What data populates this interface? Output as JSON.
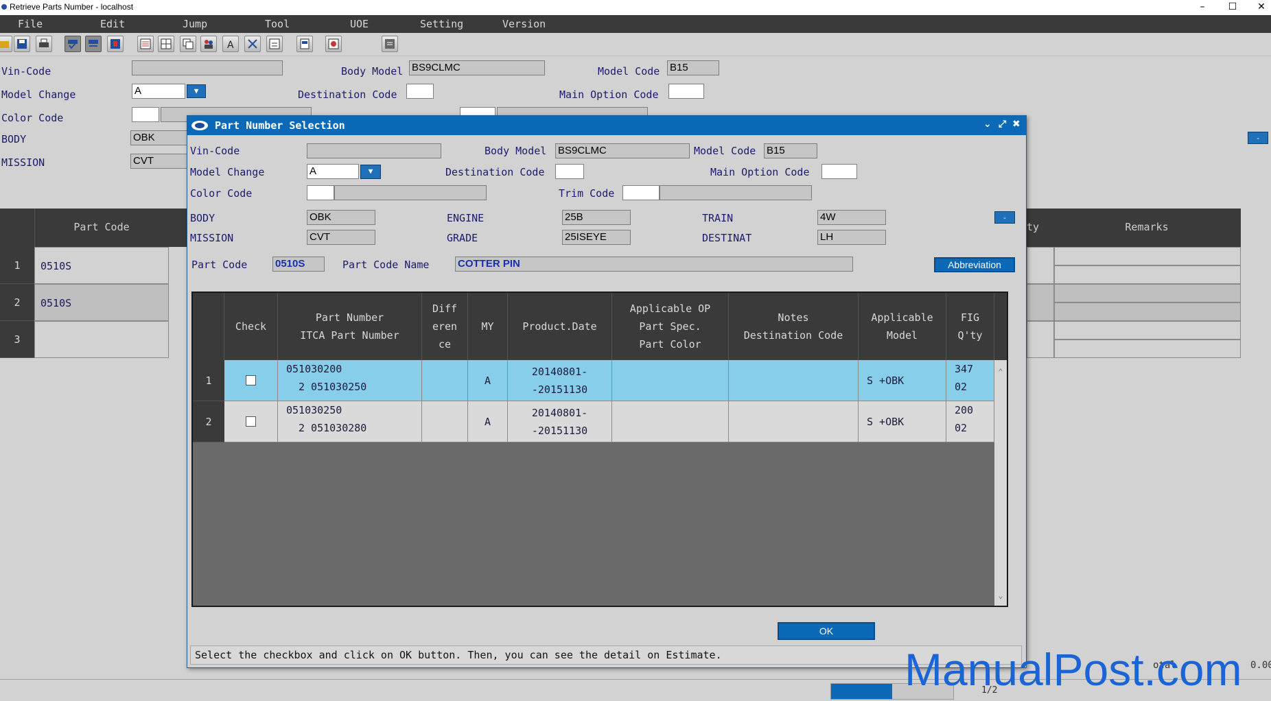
{
  "window": {
    "title": "Retrieve Parts Number - localhost",
    "min_icon": "minimize-icon",
    "max_icon": "maximize-icon",
    "close_icon": "close-icon"
  },
  "menu": [
    "File",
    "Edit",
    "Jump",
    "Tool",
    "UOE",
    "Setting",
    "Version"
  ],
  "background_form": {
    "vin_code_label": "Vin-Code",
    "body_model_label": "Body Model",
    "body_model_value": "BS9CLMC",
    "model_code_label": "Model Code",
    "model_code_value": "B15",
    "model_change_label": "Model Change",
    "model_change_value": "A",
    "destination_code_label": "Destination Code",
    "main_option_code_label": "Main Option Code",
    "color_code_label": "Color Code",
    "body_label": "BODY",
    "body_value": "OBK",
    "mission_label": "MISSION",
    "mission_value": "CVT",
    "side_button": "-"
  },
  "background_table": {
    "headers": {
      "part_code": "Part Code",
      "qty_partial": "ty",
      "remarks": "Remarks"
    },
    "rows": [
      {
        "num": "1",
        "part_code": "0510S"
      },
      {
        "num": "2",
        "part_code": "0510S"
      },
      {
        "num": "3",
        "part_code": ""
      }
    ]
  },
  "dialog": {
    "title": "Part Number Selection",
    "vin_code_label": "Vin-Code",
    "body_model_label": "Body Model",
    "body_model_value": "BS9CLMC",
    "model_code_label": "Model Code",
    "model_code_value": "B15",
    "model_change_label": "Model Change",
    "model_change_value": "A",
    "destination_code_label": "Destination Code",
    "main_option_code_label": "Main Option Code",
    "color_code_label": "Color Code",
    "trim_code_label": "Trim Code",
    "body_label": "BODY",
    "body_value": "OBK",
    "engine_label": "ENGINE",
    "engine_value": "25B",
    "train_label": "TRAIN",
    "train_value": "4W",
    "mission_label": "MISSION",
    "mission_value": "CVT",
    "grade_label": "GRADE",
    "grade_value": "25ISEYE",
    "destinat_label": "DESTINAT",
    "destinat_value": "LH",
    "side_button": "-",
    "part_code_label": "Part Code",
    "part_code_value": "0510S",
    "part_code_name_label": "Part Code Name",
    "part_code_name_value": "COTTER PIN",
    "abbreviation_button": "Abbreviation",
    "grid": {
      "headers": {
        "check": "Check",
        "part_number_1": "Part Number",
        "part_number_2": "ITCA Part Number",
        "diff_1": "Diff",
        "diff_2": "eren",
        "diff_3": "ce",
        "my": "MY",
        "product_date": "Product.Date",
        "applicable_op_1": "Applicable OP",
        "applicable_op_2": "Part Spec.",
        "applicable_op_3": "Part Color",
        "notes_1": "Notes",
        "notes_2": "Destination Code",
        "applicable_model_1": "Applicable",
        "applicable_model_2": "Model",
        "fig_1": "FIG",
        "fig_2": "Q'ty"
      },
      "rows": [
        {
          "num": "1",
          "checked": false,
          "part_number": "051030200",
          "itca": "2 051030250",
          "diff": "",
          "my": "A",
          "date_from": "20140801-",
          "date_to": "-20151130",
          "op": "",
          "notes": "",
          "model": "S +OBK",
          "fig": "347",
          "qty": "02",
          "selected": true
        },
        {
          "num": "2",
          "checked": false,
          "part_number": "051030250",
          "itca": "2 051030280",
          "diff": "",
          "my": "A",
          "date_from": "20140801-",
          "date_to": "-20151130",
          "op": "",
          "notes": "",
          "model": "S +OBK",
          "fig": "200",
          "qty": "02",
          "selected": false
        }
      ]
    },
    "ok_button": "OK",
    "status_message": "Select the checkbox and click on OK button. Then, you can see the detail on Estimate."
  },
  "statusbar": {
    "page_indicator": "1/2",
    "total_partial": "otal",
    "total_value_partial": "0.00"
  },
  "watermark": "ManualPost.com",
  "colors": {
    "accent": "#0b69b7",
    "selected_row": "#87ceeb",
    "menubar": "#3a3a3a"
  }
}
